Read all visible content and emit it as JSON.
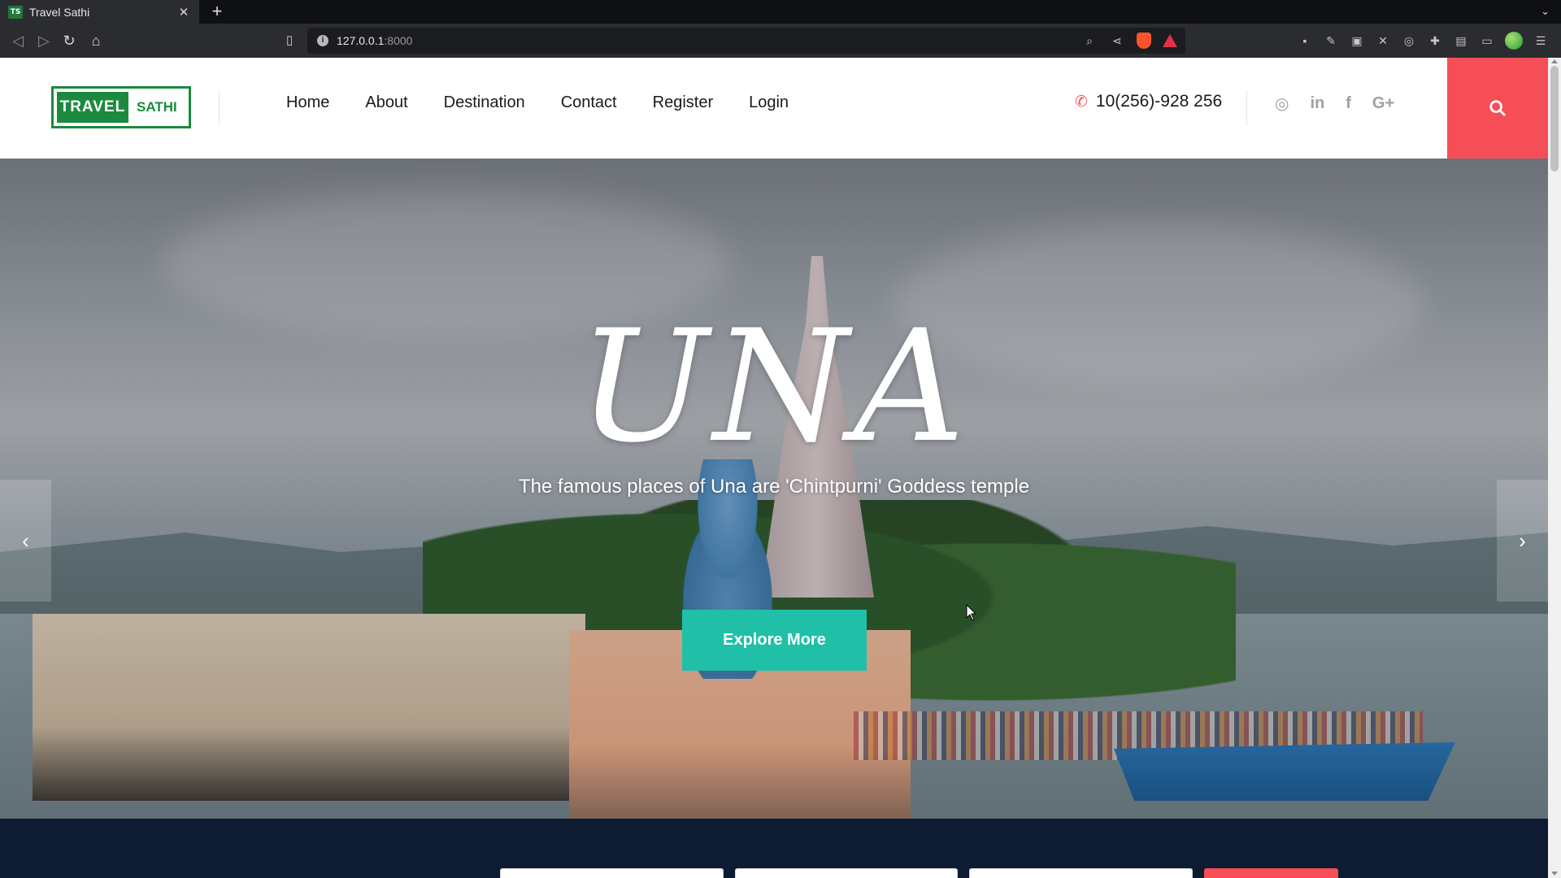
{
  "browser": {
    "tab_title": "Travel Sathi",
    "tab_favicon": "TS",
    "url_host": "127.0.0.1",
    "url_port": ":8000"
  },
  "header": {
    "logo_left": "TRAVEL",
    "logo_right": "SATHI",
    "menu": [
      {
        "label": "Home"
      },
      {
        "label": "About"
      },
      {
        "label": "Destination"
      },
      {
        "label": "Contact"
      },
      {
        "label": "Register"
      },
      {
        "label": "Login"
      }
    ],
    "phone": "10(256)-928 256",
    "social_icons": [
      "instagram-icon",
      "linkedin-icon",
      "facebook-icon",
      "google-plus-icon"
    ]
  },
  "hero": {
    "title": "UNA",
    "subtitle": "The famous places of Una are 'Chintpurni' Goddess temple",
    "button_label": "Explore More"
  },
  "colors": {
    "accent_red": "#f54e56",
    "accent_teal": "#1fc0a7",
    "brand_green": "#1b8a3e",
    "footer_navy": "#0e1c33"
  }
}
